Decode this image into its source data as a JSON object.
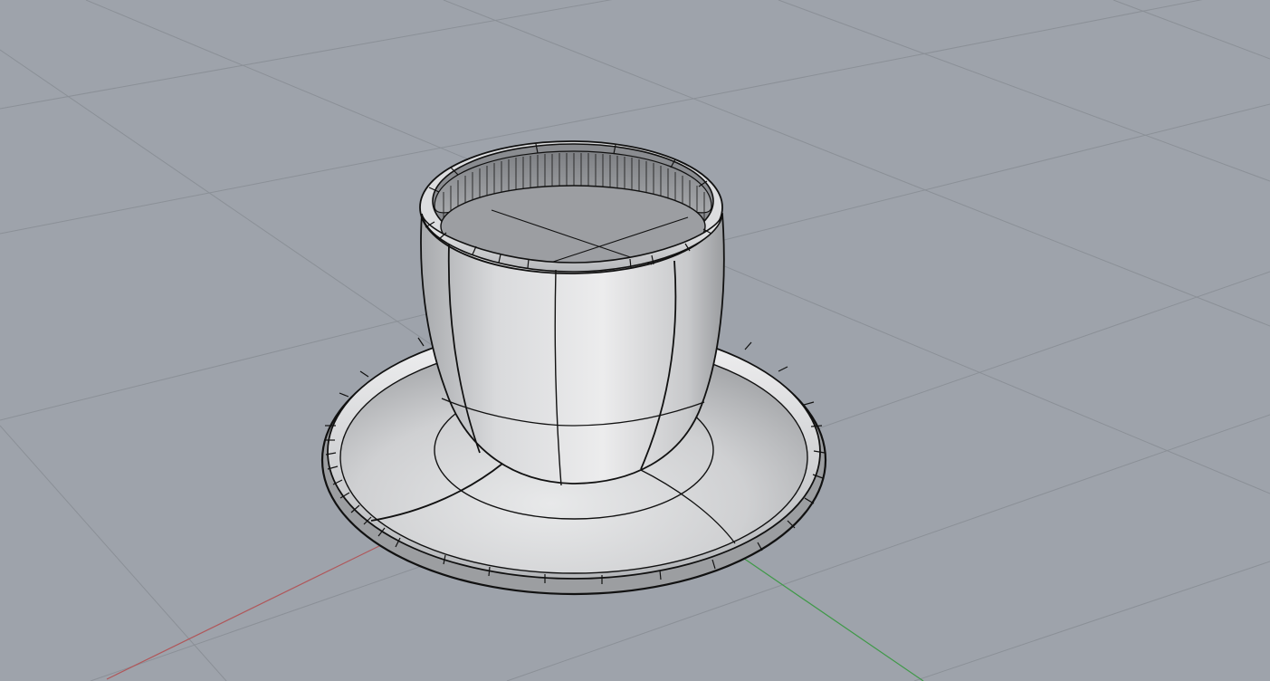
{
  "viewport": {
    "background_color": "#9ea3ab",
    "grid_color": "#8b9097",
    "grid_visible": true,
    "view": "perspective"
  },
  "axes": {
    "x_axis_color": "#b0575a",
    "y_axis_color": "#3f9a48"
  },
  "model": {
    "objects": [
      "cup",
      "saucer"
    ],
    "display_mode": "shaded",
    "surface_color": "#c9cacc",
    "edge_color": "#111111"
  }
}
